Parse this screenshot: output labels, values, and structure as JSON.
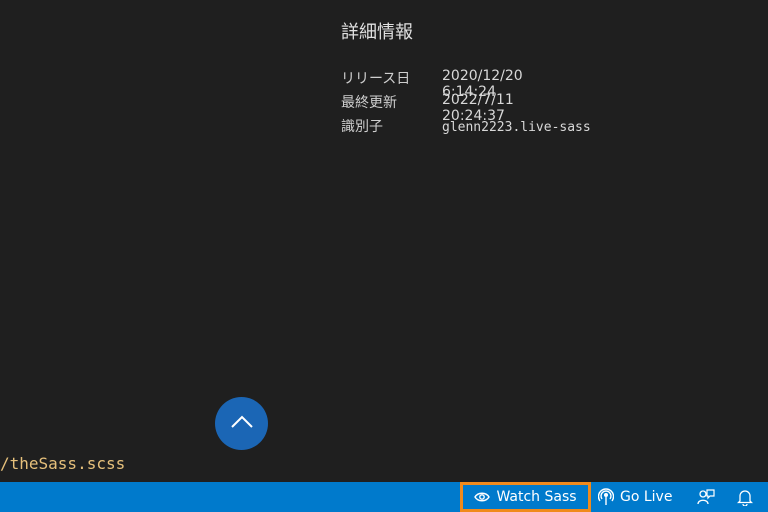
{
  "details": {
    "heading": "詳細情報",
    "rows": [
      {
        "label": "リリース日",
        "value": "2020/12/20 6:14:24"
      },
      {
        "label": "最終更新",
        "value": "2022/7/11 20:24:37"
      },
      {
        "label": "識別子",
        "value": "glenn2223.live-sass"
      }
    ]
  },
  "scroll_to_top": {
    "icon": "chevron-up-icon"
  },
  "editor": {
    "path_fragment": "/theSass.scss"
  },
  "statusbar": {
    "background": "#007acc",
    "highlight_color": "#f08a1c",
    "watch_sass": {
      "label": "Watch Sass",
      "icon": "eye-icon"
    },
    "go_live": {
      "label": "Go Live",
      "icon": "broadcast-icon"
    },
    "feedback": {
      "icon": "feedback-icon"
    },
    "notifications": {
      "icon": "bell-icon"
    }
  }
}
